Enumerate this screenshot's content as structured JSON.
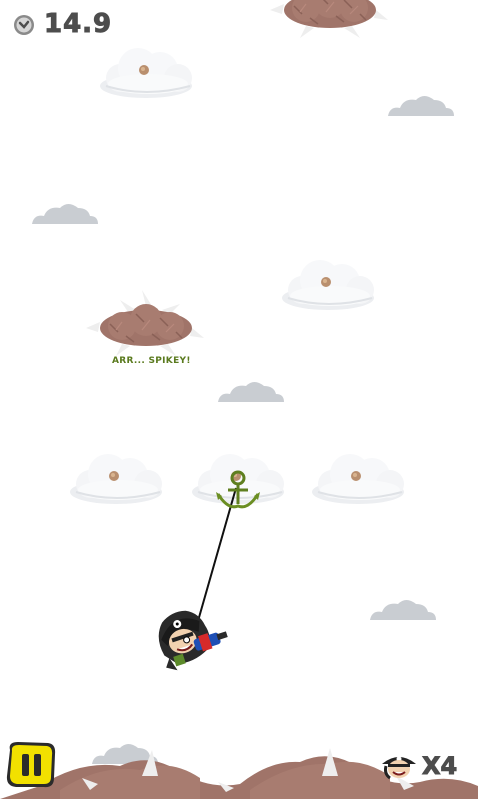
{
  "hud": {
    "timer_icon": "stopwatch-icon",
    "timer_value": "14.9",
    "pause_icon": "pause-icon",
    "lives_icon": "pirate-head-icon",
    "lives_text": "X4"
  },
  "scene": {
    "hazard_caption": "ARR... SPIKEY!",
    "colors": {
      "sky": "#ffffff",
      "cloud": "#f4f5f7",
      "cloud_shadow": "#d9dde3",
      "distant_cloud": "#c8ccd1",
      "spiky_cloud": "#a0756b",
      "spikes": "#f2f2f2",
      "grapple": "#6b8e23",
      "pause_button": "#f2e100",
      "hud_text": "#4d4d4d",
      "caption": "#5a7a1e"
    }
  }
}
